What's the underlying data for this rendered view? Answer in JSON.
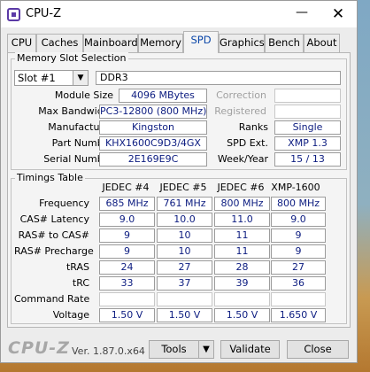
{
  "window": {
    "title": "CPU-Z",
    "minimize_glyph": "—",
    "close_glyph": "✕"
  },
  "tabs": [
    {
      "label": "CPU",
      "active": false
    },
    {
      "label": "Caches",
      "active": false
    },
    {
      "label": "Mainboard",
      "active": false
    },
    {
      "label": "Memory",
      "active": false
    },
    {
      "label": "SPD",
      "active": true
    },
    {
      "label": "Graphics",
      "active": false
    },
    {
      "label": "Bench",
      "active": false
    },
    {
      "label": "About",
      "active": false
    }
  ],
  "memory_slot": {
    "legend": "Memory Slot Selection",
    "slot_selected": "Slot #1",
    "memory_type": "DDR3",
    "module_size_label": "Module Size",
    "module_size": "4096 MBytes",
    "max_bandwidth_label": "Max Bandwidth",
    "max_bandwidth": "PC3-12800 (800 MHz)",
    "manufacturer_label": "Manufacturer",
    "manufacturer": "Kingston",
    "part_number_label": "Part Number",
    "part_number": "KHX1600C9D3/4GX",
    "serial_number_label": "Serial Number",
    "serial_number": "2E169E9C",
    "correction_label": "Correction",
    "correction": "",
    "registered_label": "Registered",
    "registered": "",
    "ranks_label": "Ranks",
    "ranks": "Single",
    "spd_ext_label": "SPD Ext.",
    "spd_ext": "XMP 1.3",
    "week_year_label": "Week/Year",
    "week_year": "15 / 13"
  },
  "timings": {
    "legend": "Timings Table",
    "columns": [
      "JEDEC #4",
      "JEDEC #5",
      "JEDEC #6",
      "XMP-1600"
    ],
    "rows": [
      {
        "label": "Frequency",
        "values": [
          "685 MHz",
          "761 MHz",
          "800 MHz",
          "800 MHz"
        ]
      },
      {
        "label": "CAS# Latency",
        "values": [
          "9.0",
          "10.0",
          "11.0",
          "9.0"
        ]
      },
      {
        "label": "RAS# to CAS#",
        "values": [
          "9",
          "10",
          "11",
          "9"
        ]
      },
      {
        "label": "RAS# Precharge",
        "values": [
          "9",
          "10",
          "11",
          "9"
        ]
      },
      {
        "label": "tRAS",
        "values": [
          "24",
          "27",
          "28",
          "27"
        ]
      },
      {
        "label": "tRC",
        "values": [
          "33",
          "37",
          "39",
          "36"
        ]
      },
      {
        "label": "Command Rate",
        "values": [
          "",
          "",
          "",
          ""
        ]
      },
      {
        "label": "Voltage",
        "values": [
          "1.50 V",
          "1.50 V",
          "1.50 V",
          "1.650 V"
        ]
      }
    ]
  },
  "footer": {
    "brand": "CPU-Z",
    "version": "Ver. 1.87.0.x64",
    "tools_label": "Tools",
    "tools_arrow": "▼",
    "validate_label": "Validate",
    "close_label": "Close"
  }
}
